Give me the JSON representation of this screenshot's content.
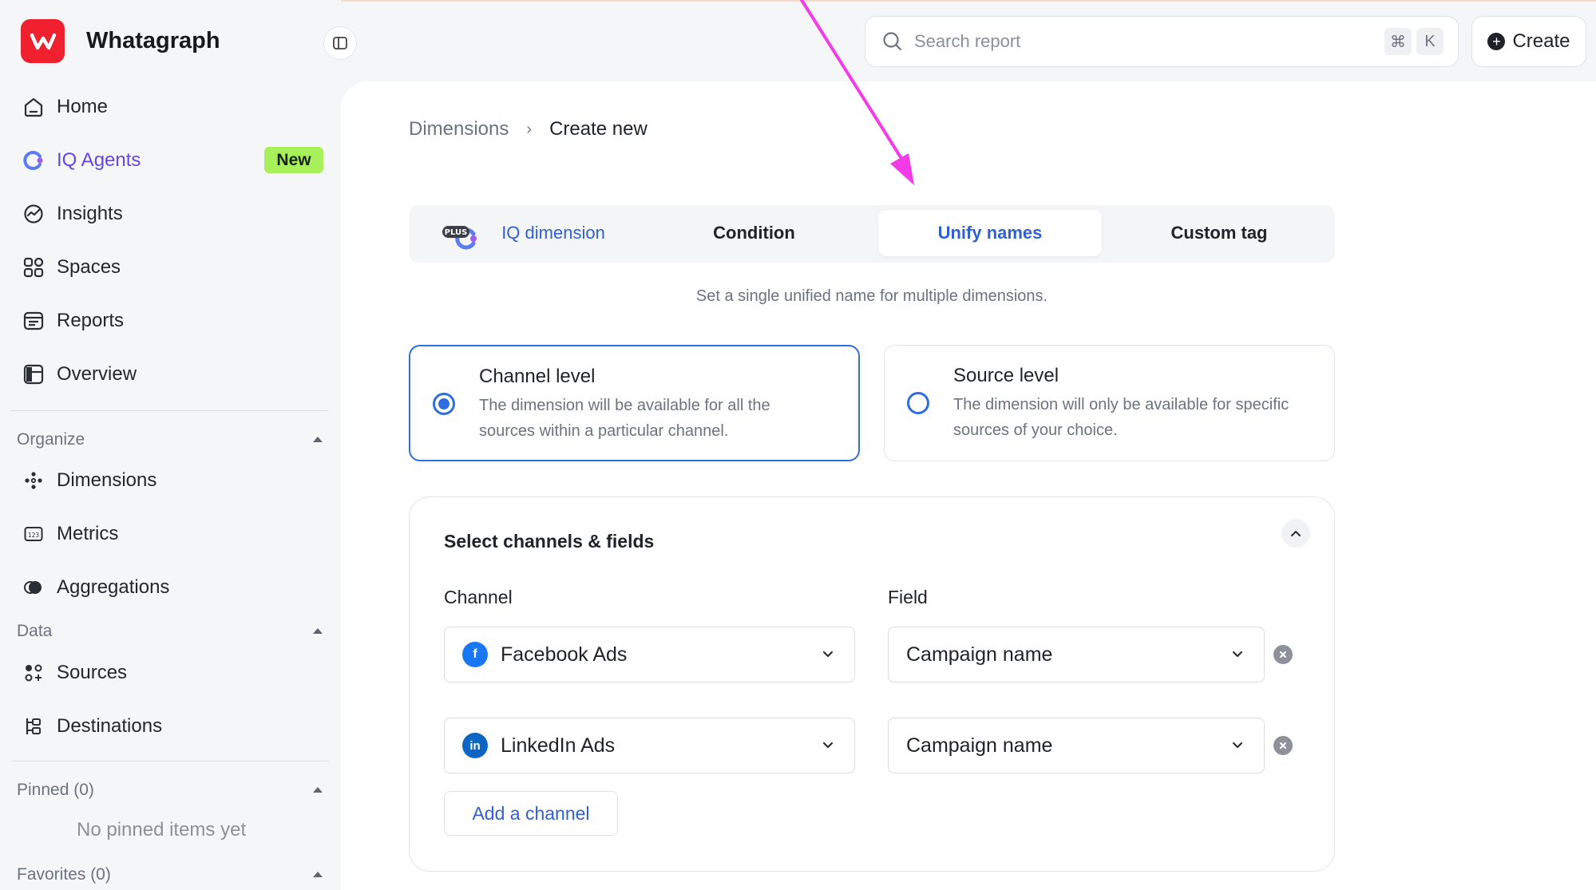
{
  "brand": {
    "name": "Whatagraph",
    "logo_letter": "w"
  },
  "nav": [
    {
      "label": "Home",
      "icon": "home-icon"
    },
    {
      "label": "IQ Agents",
      "icon": "iq-agents-icon",
      "badge": "New"
    },
    {
      "label": "Insights",
      "icon": "insights-icon"
    },
    {
      "label": "Spaces",
      "icon": "spaces-icon"
    },
    {
      "label": "Reports",
      "icon": "reports-icon"
    },
    {
      "label": "Overview",
      "icon": "overview-icon"
    }
  ],
  "organize": {
    "heading": "Organize",
    "items": [
      {
        "label": "Dimensions",
        "icon": "dimensions-icon"
      },
      {
        "label": "Metrics",
        "icon": "metrics-icon"
      },
      {
        "label": "Aggregations",
        "icon": "aggregations-icon"
      }
    ]
  },
  "data_section": {
    "heading": "Data",
    "items": [
      {
        "label": "Sources",
        "icon": "sources-icon"
      },
      {
        "label": "Destinations",
        "icon": "destinations-icon"
      }
    ]
  },
  "pinned": {
    "heading": "Pinned (0)",
    "empty": "No pinned items yet"
  },
  "favorites": {
    "heading": "Favorites (0)"
  },
  "search": {
    "placeholder": "Search report",
    "key1": "⌘",
    "key2": "K"
  },
  "create": {
    "label": "Create"
  },
  "breadcrumb": {
    "parent": "Dimensions",
    "separator": "›",
    "current": "Create new"
  },
  "tabs": [
    {
      "label": "IQ dimension",
      "badge": "PLUS"
    },
    {
      "label": "Condition"
    },
    {
      "label": "Unify names",
      "selected": true
    },
    {
      "label": "Custom tag"
    }
  ],
  "subtitle": "Set a single unified name for multiple dimensions.",
  "levels": [
    {
      "title": "Channel level",
      "desc": "The dimension will be available for all the sources within a particular channel.",
      "selected": true
    },
    {
      "title": "Source level",
      "desc": "The dimension will only be available for specific sources of your choice.",
      "selected": false
    }
  ],
  "fields_section": {
    "title": "Select channels & fields",
    "channel_label": "Channel",
    "field_label": "Field",
    "rows": [
      {
        "channel": "Facebook Ads",
        "channel_icon": "facebook-icon",
        "field": "Campaign name"
      },
      {
        "channel": "LinkedIn Ads",
        "channel_icon": "linkedin-icon",
        "field": "Campaign name"
      }
    ],
    "add_label": "Add a channel"
  },
  "colors": {
    "accent": "#2f6de3",
    "brand": "#f0202e",
    "iq": "#6645e8",
    "new_badge": "#a8f05a",
    "annotation_arrow": "#f53ae8"
  }
}
